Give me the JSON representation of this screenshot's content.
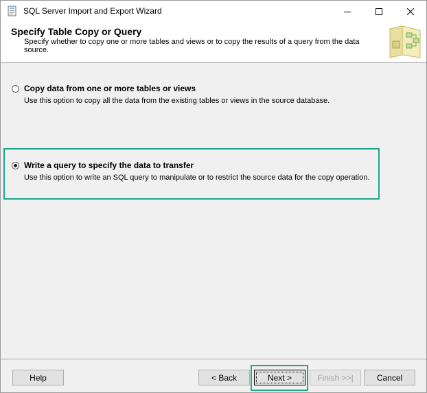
{
  "window": {
    "title": "SQL Server Import and Export Wizard",
    "app_icon": "wizard-app-icon",
    "controls": [
      "minimize-icon",
      "maximize-icon",
      "close-icon"
    ]
  },
  "header": {
    "title": "Specify Table Copy or Query",
    "description": "Specify whether to copy one or more tables and views or to copy the results of a query from the data source.",
    "graphic_icon": "table-copy-graphic-icon"
  },
  "options": [
    {
      "label": "Copy data from one or more tables or views",
      "description": "Use this option to copy all the data from the existing tables or views in the source database.",
      "selected": false
    },
    {
      "label": "Write a query to specify the data to transfer",
      "description": "Use this option to write an SQL query to manipulate or to restrict the source data for the copy operation.",
      "selected": true
    }
  ],
  "buttons": {
    "help": "Help",
    "back": "< Back",
    "next": "Next >",
    "finish": "Finish >>|",
    "cancel": "Cancel"
  },
  "colors": {
    "highlight": "#1da68a",
    "disabled_text": "#a0a0a0"
  }
}
